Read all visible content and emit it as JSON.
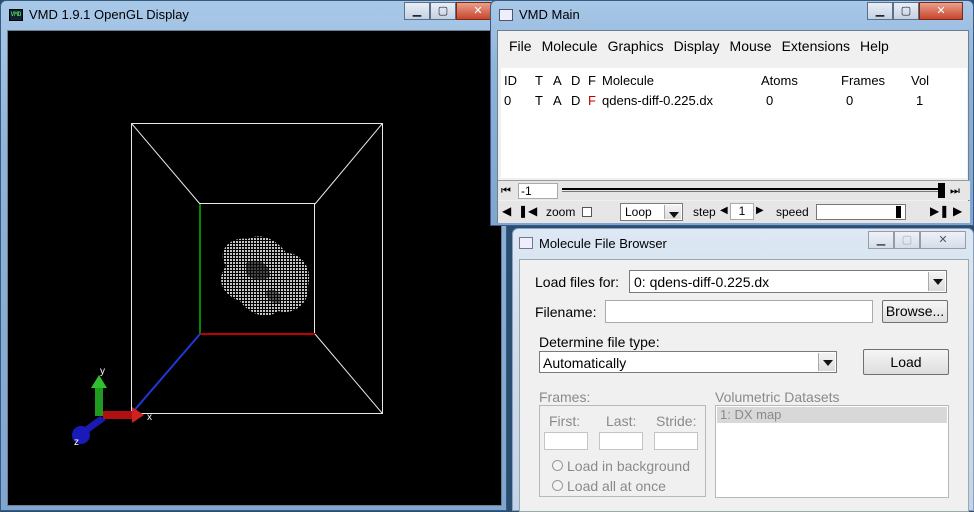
{
  "gl_window": {
    "title": "VMD 1.9.1 OpenGL Display",
    "axes": {
      "x": "x",
      "y": "y",
      "z": "z"
    }
  },
  "main_window": {
    "title": "VMD Main",
    "menu": [
      "File",
      "Molecule",
      "Graphics",
      "Display",
      "Mouse",
      "Extensions",
      "Help"
    ],
    "columns": [
      "ID",
      "T",
      "A",
      "D",
      "F",
      "Molecule",
      "Atoms",
      "Frames",
      "Vol"
    ],
    "rows": [
      {
        "id": "0",
        "t": "T",
        "a": "A",
        "d": "D",
        "f": "F",
        "molecule": "qdens-diff-0.225.dx",
        "atoms": "0",
        "frames": "0",
        "vol": "1"
      }
    ],
    "frame_field": "-1",
    "zoom_label": "zoom",
    "loop_value": "Loop",
    "step_label": "step",
    "step_value": "1",
    "speed_label": "speed",
    "colors": {
      "f_flag": "#c00000"
    }
  },
  "browser": {
    "title": "Molecule File Browser",
    "load_files_label": "Load files for:",
    "load_files_value": "0: qdens-diff-0.225.dx",
    "filename_label": "Filename:",
    "filename_value": "",
    "browse_label": "Browse...",
    "file_type_label": "Determine file type:",
    "file_type_value": "Automatically",
    "load_label": "Load",
    "frames_label": "Frames:",
    "first_label": "First:",
    "last_label": "Last:",
    "stride_label": "Stride:",
    "bg_label": "Load in background",
    "all_label": "Load all at once",
    "vol_label": "Volumetric Datasets",
    "vol_items": [
      "1: DX map"
    ]
  },
  "icons": [
    "minimize-icon",
    "maximize-icon",
    "close-icon"
  ]
}
